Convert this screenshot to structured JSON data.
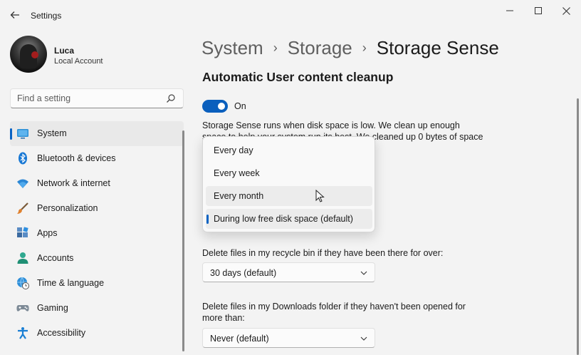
{
  "window": {
    "app_title": "Settings",
    "controls": {
      "minimize": "—",
      "maximize": "☐",
      "close": "✕"
    }
  },
  "profile": {
    "name": "Luca",
    "account_type": "Local Account"
  },
  "search": {
    "placeholder": "Find a setting"
  },
  "sidebar": {
    "items": [
      {
        "label": "System",
        "icon": "system-icon",
        "selected": true
      },
      {
        "label": "Bluetooth & devices",
        "icon": "bluetooth-icon"
      },
      {
        "label": "Network & internet",
        "icon": "wifi-icon"
      },
      {
        "label": "Personalization",
        "icon": "brush-icon"
      },
      {
        "label": "Apps",
        "icon": "apps-icon"
      },
      {
        "label": "Accounts",
        "icon": "accounts-icon"
      },
      {
        "label": "Time & language",
        "icon": "globe-clock-icon"
      },
      {
        "label": "Gaming",
        "icon": "gamepad-icon"
      },
      {
        "label": "Accessibility",
        "icon": "accessibility-icon"
      }
    ]
  },
  "breadcrumb": {
    "part1": "System",
    "part2": "Storage",
    "current": "Storage Sense",
    "separator": "›"
  },
  "main": {
    "section_title": "Automatic User content cleanup",
    "toggle_label": "On",
    "toggle_on": true,
    "description": "Storage Sense runs when disk space is low. We clean up enough space to help your system run its best. We cleaned up 0 bytes of space in the",
    "run_options": [
      {
        "label": "Every day"
      },
      {
        "label": "Every week"
      },
      {
        "label": "Every month",
        "hover": true
      },
      {
        "label": "During low free disk space (default)",
        "selected": true
      }
    ],
    "recycle_label": "Delete files in my recycle bin if they have been there for over:",
    "recycle_value": "30 days (default)",
    "downloads_label": "Delete files in my Downloads folder if they haven't been opened for more than:",
    "downloads_value": "Never (default)"
  },
  "colors": {
    "accent": "#0a63c3",
    "toggle": "#0a5fbd"
  }
}
